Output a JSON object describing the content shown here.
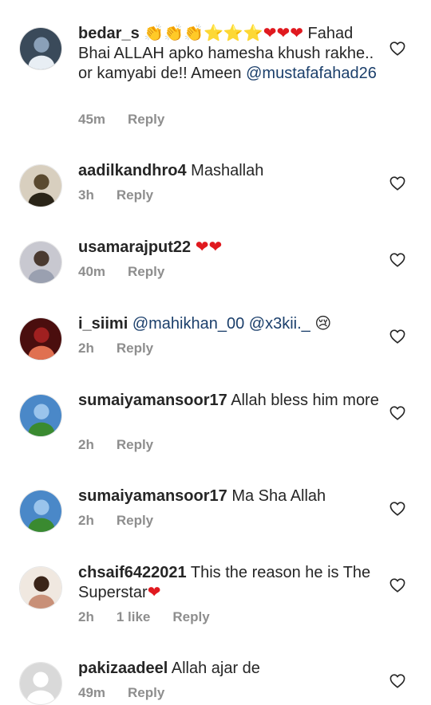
{
  "comments": [
    {
      "username": "bedar_s",
      "text_parts": [
        {
          "t": " 👏👏👏⭐⭐⭐",
          "k": "plain"
        },
        {
          "t": "❤❤❤",
          "k": "heart"
        },
        {
          "t": " Fahad Bhai ALLAH apko hamesha khush rakhe.. or kamyabi de!! Ameen ",
          "k": "plain"
        },
        {
          "t": "@mustafafahad26",
          "k": "mention"
        }
      ],
      "time": "45m",
      "likes": "",
      "reply": "Reply"
    },
    {
      "username": "aadilkandhro4",
      "text_parts": [
        {
          "t": " Mashallah",
          "k": "plain"
        }
      ],
      "time": "3h",
      "likes": "",
      "reply": "Reply"
    },
    {
      "username": "usamarajput22",
      "text_parts": [
        {
          "t": " ",
          "k": "plain"
        },
        {
          "t": "❤❤",
          "k": "heart"
        }
      ],
      "time": "40m",
      "likes": "",
      "reply": "Reply"
    },
    {
      "username": "i_siimi",
      "text_parts": [
        {
          "t": " ",
          "k": "plain"
        },
        {
          "t": "@mahikhan_00",
          "k": "mention"
        },
        {
          "t": "  ",
          "k": "plain"
        },
        {
          "t": "@x3kii._",
          "k": "mention"
        },
        {
          "t": " 😢",
          "k": "plain"
        }
      ],
      "time": "2h",
      "likes": "",
      "reply": "Reply"
    },
    {
      "username": "sumaiyamansoor17",
      "text_parts": [
        {
          "t": " Allah bless him more",
          "k": "plain"
        }
      ],
      "time": "2h",
      "likes": "",
      "reply": "Reply"
    },
    {
      "username": "sumaiyamansoor17",
      "text_parts": [
        {
          "t": " Ma Sha Allah",
          "k": "plain"
        }
      ],
      "time": "2h",
      "likes": "",
      "reply": "Reply"
    },
    {
      "username": "chsaif6422021",
      "text_parts": [
        {
          "t": " This the reason he is The Superstar",
          "k": "plain"
        },
        {
          "t": "❤",
          "k": "heart"
        }
      ],
      "time": "2h",
      "likes": "1 like",
      "reply": "Reply"
    },
    {
      "username": "pakizaadeel",
      "text_parts": [
        {
          "t": " Allah ajar de",
          "k": "plain"
        }
      ],
      "time": "49m",
      "likes": "",
      "reply": "Reply"
    }
  ],
  "icons": {
    "like": "heart-outline-icon",
    "avatar": "profile-photo"
  },
  "colors": {
    "text": "#262626",
    "meta": "#8e8e8e",
    "mention": "#1b3f6b",
    "heart": "#e0191f"
  }
}
